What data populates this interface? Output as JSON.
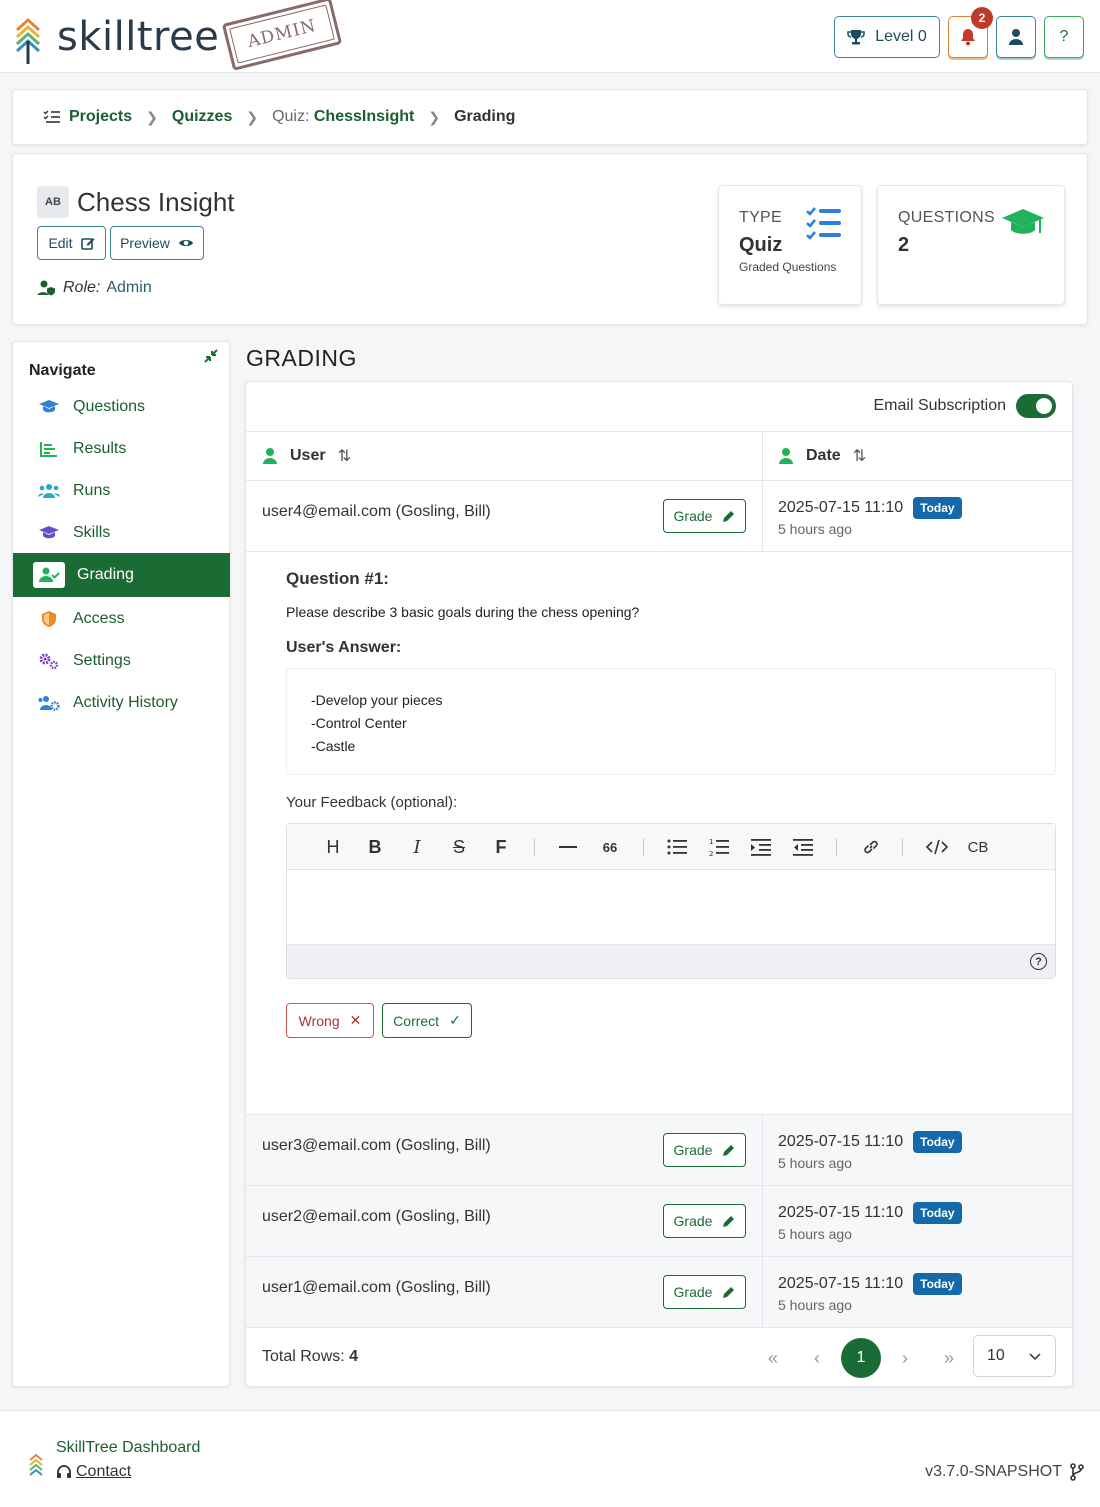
{
  "app": {
    "logo_text": "skilltree",
    "stamp": "ADMIN"
  },
  "topbar": {
    "level_label": "Level 0",
    "notification_count": "2",
    "help_label": "?"
  },
  "breadcrumb": {
    "items": [
      {
        "label": "Projects"
      },
      {
        "label": "Quizzes"
      },
      {
        "prefix": "Quiz:",
        "label": "ChessInsight"
      },
      {
        "label": "Grading"
      }
    ]
  },
  "header": {
    "icon_text": "AB",
    "title": "Chess Insight",
    "edit_label": "Edit",
    "preview_label": "Preview",
    "role_label": "Role:",
    "role_value": "Admin",
    "stats": {
      "type": {
        "label": "TYPE",
        "value": "Quiz",
        "sub": "Graded Questions"
      },
      "questions": {
        "label": "QUESTIONS",
        "value": "2"
      }
    }
  },
  "nav": {
    "title": "Navigate",
    "items": [
      {
        "label": "Questions",
        "icon": "graduation-cap-icon"
      },
      {
        "label": "Results",
        "icon": "chart-icon"
      },
      {
        "label": "Runs",
        "icon": "users-icon"
      },
      {
        "label": "Skills",
        "icon": "graduation-cap-icon"
      },
      {
        "label": "Grading",
        "icon": "user-check-icon"
      },
      {
        "label": "Access",
        "icon": "shield-icon"
      },
      {
        "label": "Settings",
        "icon": "cogs-icon"
      },
      {
        "label": "Activity History",
        "icon": "users-cog-icon"
      }
    ]
  },
  "grading": {
    "title": "GRADING",
    "email_subscription_label": "Email Subscription",
    "columns": {
      "user": "User",
      "date": "Date"
    },
    "grade_label": "Grade",
    "today_label": "Today",
    "rows": [
      {
        "user": "user4@email.com (Gosling, Bill)",
        "date": "2025-07-15 11:10",
        "ago": "5 hours ago"
      },
      {
        "user": "user3@email.com (Gosling, Bill)",
        "date": "2025-07-15 11:10",
        "ago": "5 hours ago"
      },
      {
        "user": "user2@email.com (Gosling, Bill)",
        "date": "2025-07-15 11:10",
        "ago": "5 hours ago"
      },
      {
        "user": "user1@email.com (Gosling, Bill)",
        "date": "2025-07-15 11:10",
        "ago": "5 hours ago"
      }
    ],
    "expanded": {
      "question_title": "Question #1:",
      "question_text": "Please describe 3 basic goals during the chess opening?",
      "answer_label": "User's Answer:",
      "answer_lines": [
        "-Develop your pieces",
        "-Control Center",
        "-Castle"
      ],
      "feedback_label": "Your Feedback (optional):",
      "toolbar": {
        "heading": "H",
        "bold": "B",
        "italic": "I",
        "strike": "S",
        "font": "F",
        "quote": "66",
        "codeblock": "CB"
      },
      "wrong_label": "Wrong",
      "correct_label": "Correct"
    },
    "footer": {
      "total_label": "Total Rows:",
      "total_value": "4",
      "current_page": "1",
      "page_size": "10"
    }
  },
  "footer": {
    "title": "SkillTree Dashboard",
    "contact": "Contact",
    "version": "v3.7.0-SNAPSHOT"
  },
  "colors": {
    "primary": "#1b6b35",
    "badge": "#1369a9",
    "danger": "#c0392b"
  }
}
